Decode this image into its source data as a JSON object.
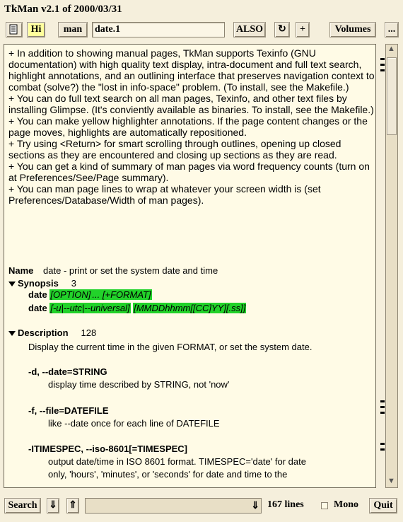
{
  "window": {
    "title": "TkMan v2.1 of 2000/03/31"
  },
  "toolbar": {
    "doc_icon": "document-icon",
    "hi_label": "Hi",
    "man_label": "man",
    "search_value": "date.1",
    "also_label": "ALSO",
    "refresh_glyph": "↻",
    "plus_label": "+",
    "volumes_label": "Volumes",
    "more_label": "..."
  },
  "intro": [
    "+ In addition to showing manual pages, TkMan supports Texinfo (GNU documentation) with high quality text display, intra-document and full text search, highlight annotations, and an outlining interface that preserves navigation context to combat (solve?) the \"lost in info-space\" problem. (To install, see the Makefile.)",
    "+ You can do full text search on all man pages, Texinfo, and other text files by installing Glimpse.  (It's conviently available as binaries.  To install, see the Makefile.)",
    "+ You can make yellow highlighter annotations.  If the page content changes or the page moves, highlights are automatically repositioned.",
    "+ Try using <Return> for smart scrolling through outlines, opening up closed sections as they are encountered and closing up sections as they are read.",
    "+ You can get a kind of summary of man pages via word frequency counts (turn on at Preferences/See/Page summary).",
    "+ You can man page lines to wrap at whatever your screen width is (set Preferences/Database/Width of man pages)."
  ],
  "manpage": {
    "name_label": "Name",
    "name_text": "date - print or set the system date and time",
    "synopsis": {
      "label": "Synopsis",
      "count": "3",
      "line1_cmd": "date",
      "line1_opt": "[OPTION]",
      "line1_rest": "... [+FORMAT]",
      "line2_cmd": "date",
      "line2_opt": "[-u|--utc|--universal]",
      "line2_rest": "[MMDDhhmm[[CC]YY][.ss]]"
    },
    "description": {
      "label": "Description",
      "count": "128",
      "intro": "Display the current time in the given FORMAT, or set the system date.",
      "opt1": "-d, --date=STRING",
      "opt1_desc": "display time described by STRING, not 'now'",
      "opt2": "-f, --file=DATEFILE",
      "opt2_desc": "like --date once for each line of DATEFILE",
      "opt3": "-ITIMESPEC, --iso-8601[=TIMESPEC]",
      "opt3_desc1": "output date/time in ISO 8601 format.  TIMESPEC='date' for date",
      "opt3_desc2": "only, 'hours', 'minutes', or 'seconds' for date and time to the"
    }
  },
  "bottom": {
    "search_label": "Search",
    "down_glyph": "⇓",
    "up_glyph": "⇑",
    "lines_text": "167 lines",
    "mono_label": "Mono",
    "quit_label": "Quit"
  }
}
